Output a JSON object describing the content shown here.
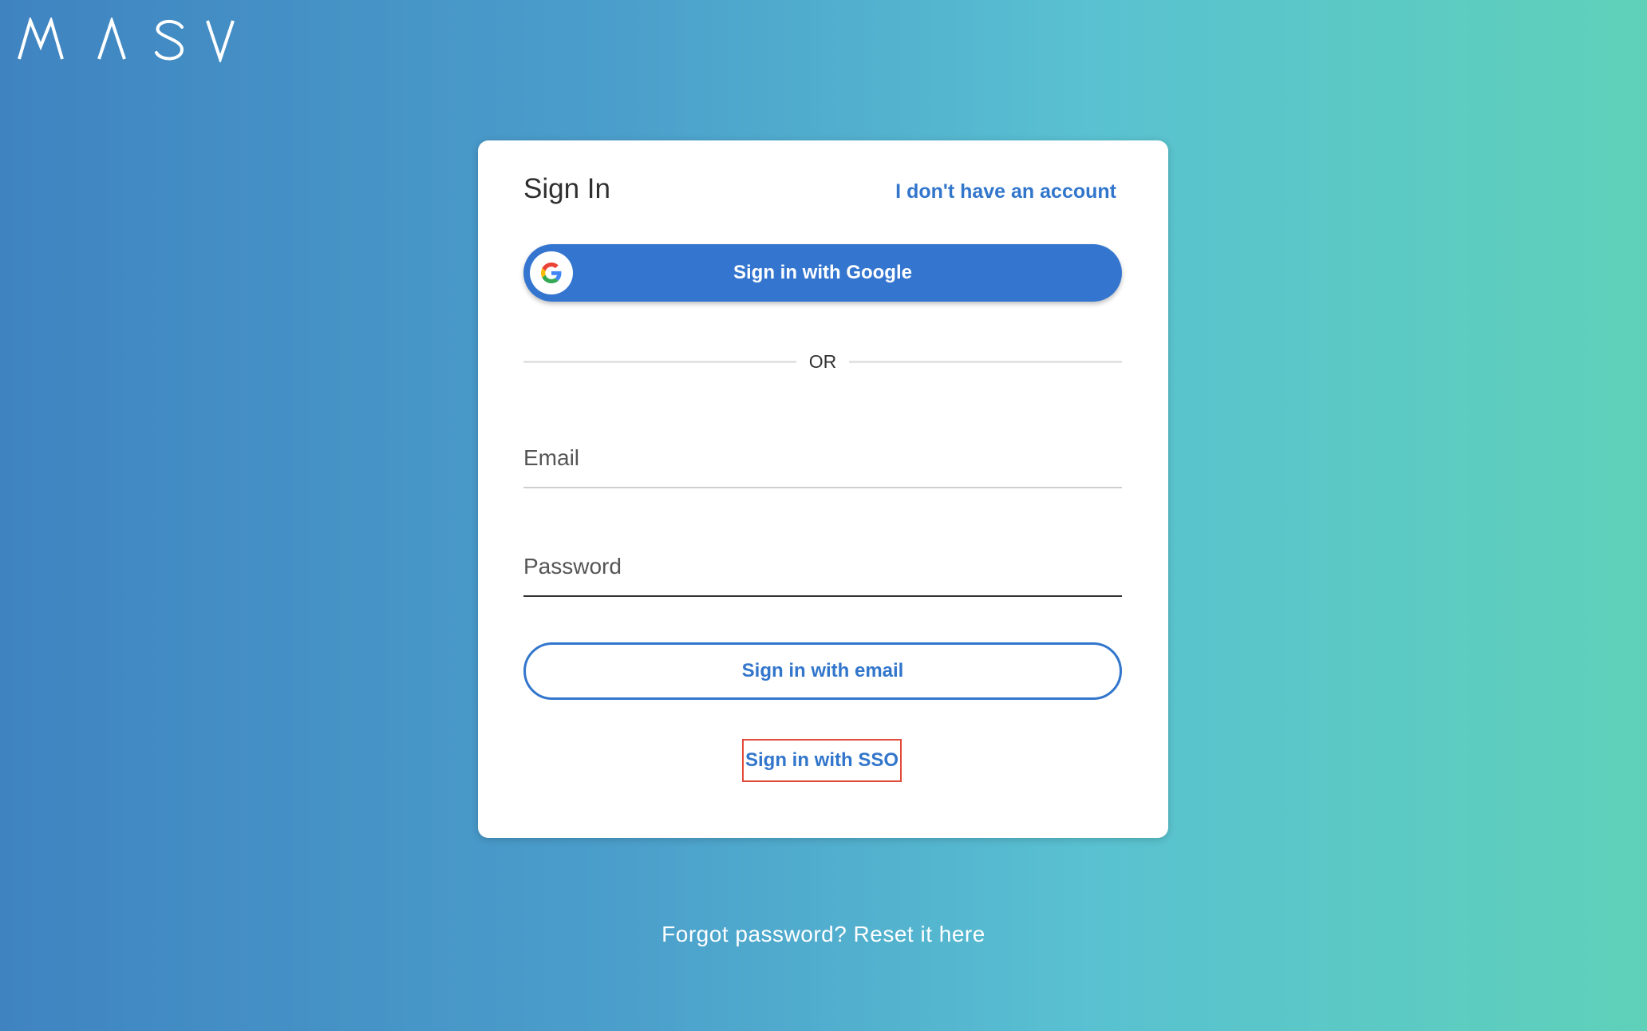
{
  "logo": {
    "text": "MASV",
    "color": "#ffffff"
  },
  "card": {
    "title": "Sign In",
    "no_account_link": "I don't have an account",
    "google_button": {
      "label": "Sign in with Google",
      "icon": "google-g-icon"
    },
    "divider_text": "OR",
    "email_field": {
      "placeholder": "Email",
      "value": ""
    },
    "password_field": {
      "placeholder": "Password",
      "value": ""
    },
    "email_button": {
      "label": "Sign in with email"
    },
    "sso_link": {
      "label": "Sign in with SSO"
    }
  },
  "footer": {
    "forgot_link": "Forgot password? Reset it here"
  },
  "colors": {
    "accent": "#3276cc",
    "google_button": "#3476cf",
    "highlight_border": "#e24a3b",
    "gradient_start": "#3f84c1",
    "gradient_end": "#5fd1b9"
  }
}
